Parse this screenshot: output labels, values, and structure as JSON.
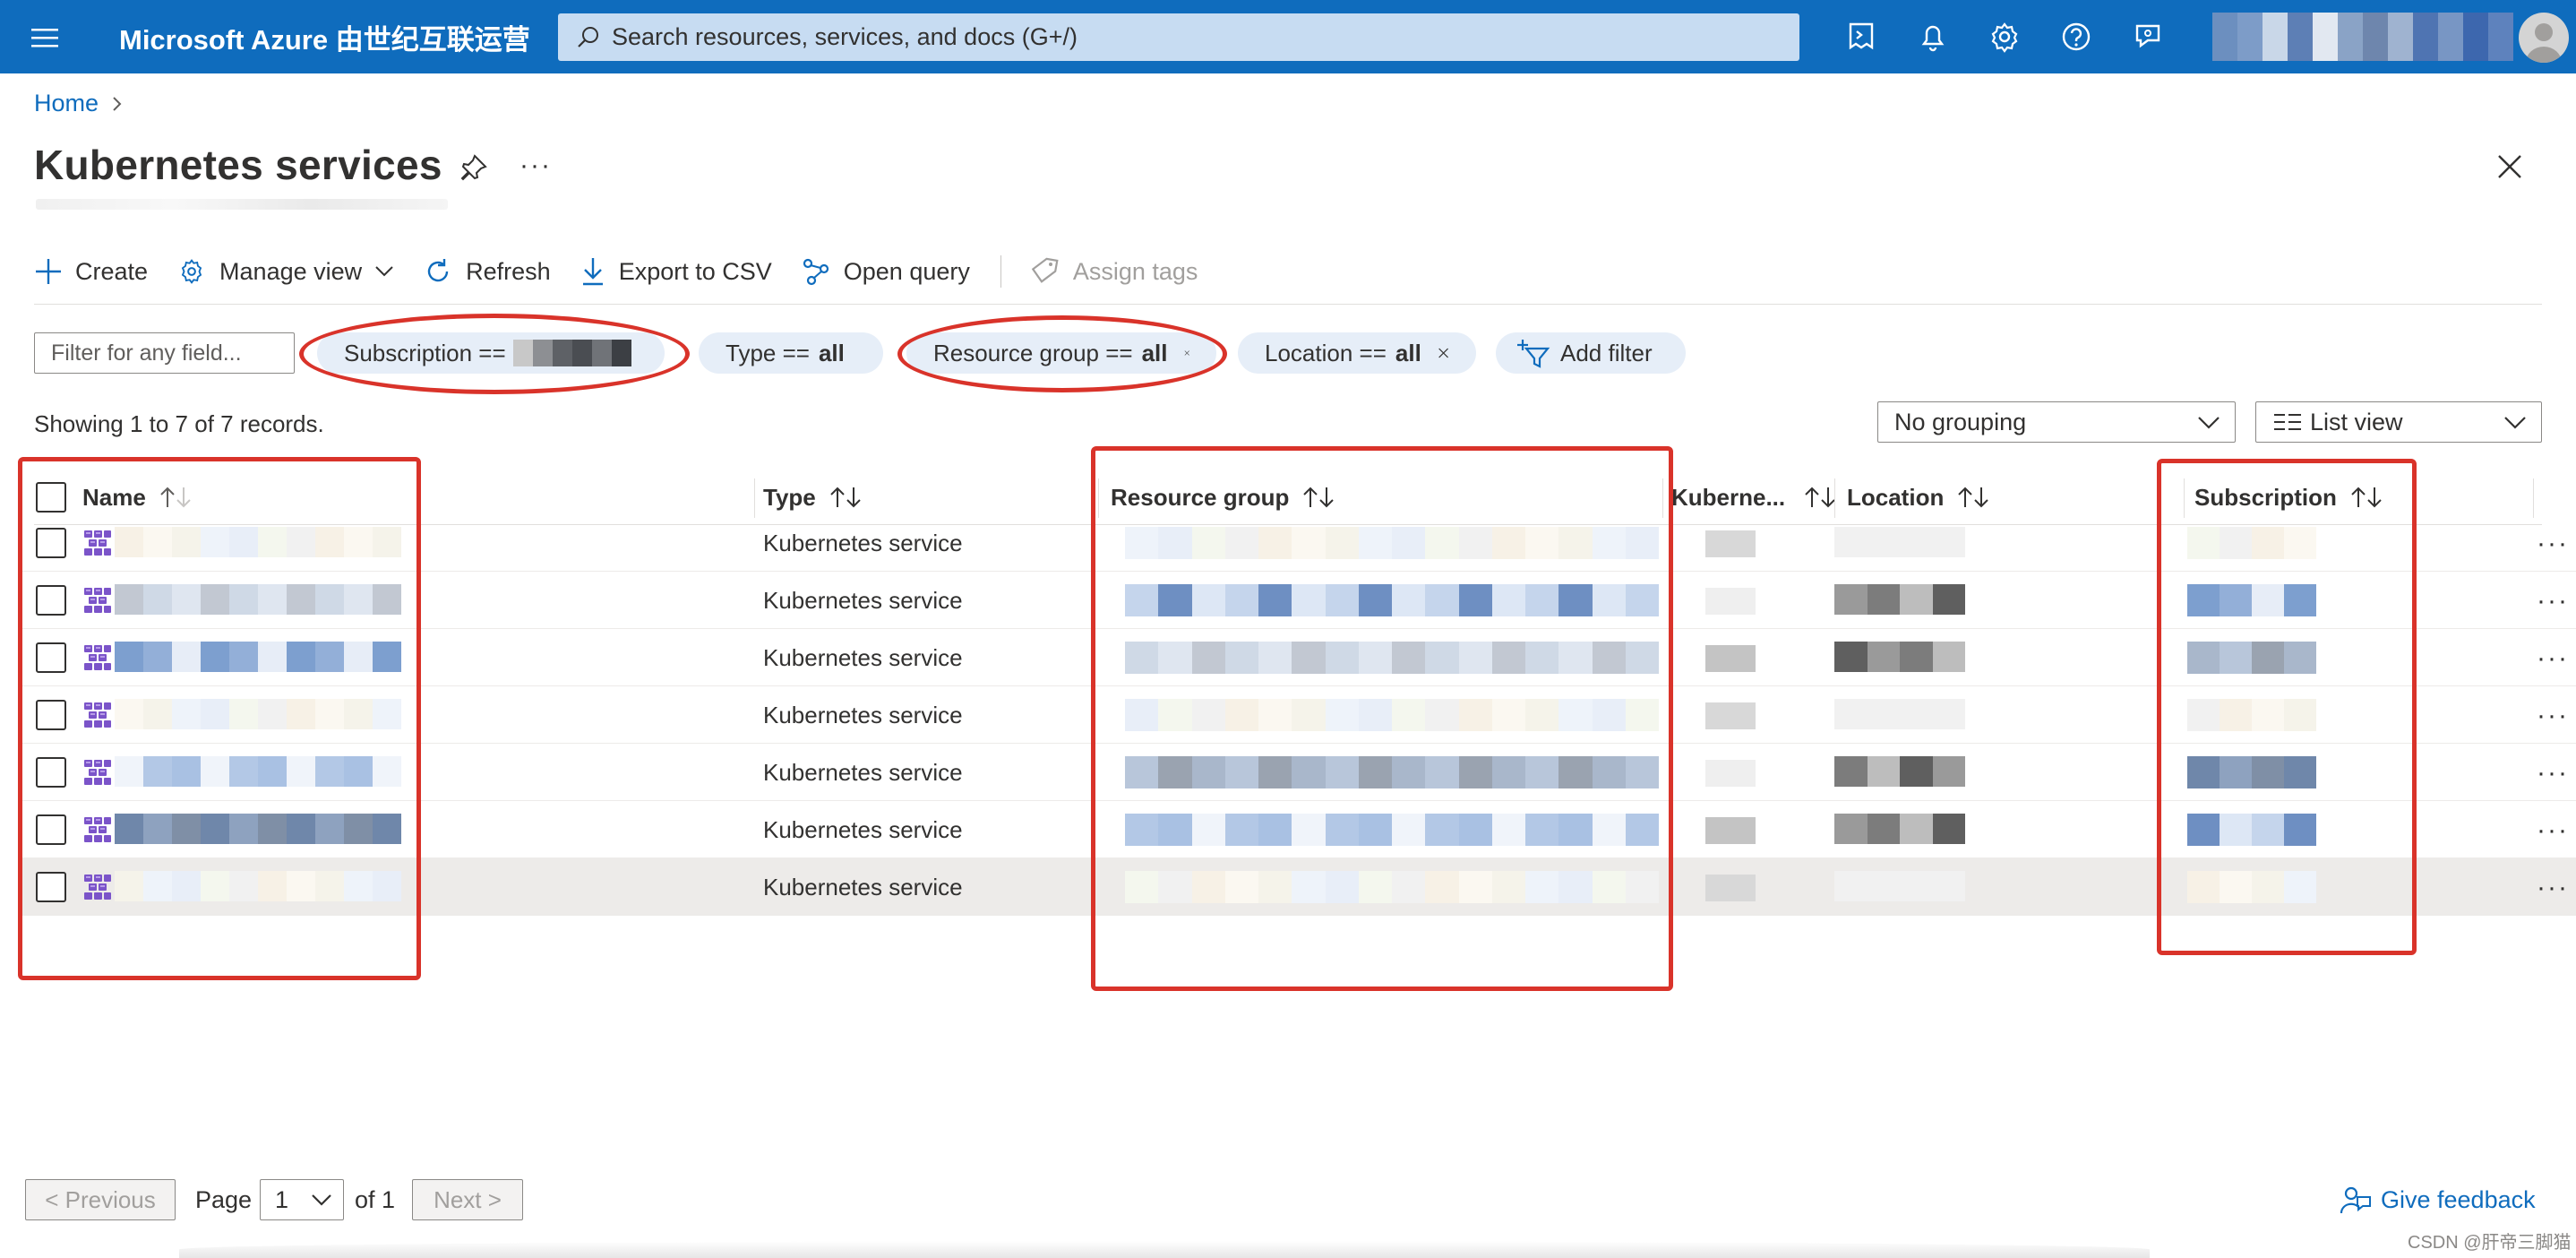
{
  "header": {
    "brand": "Microsoft Azure 由世纪互联运营",
    "search_placeholder": "Search resources, services, and docs (G+/)",
    "icons": [
      "hamburger-icon",
      "cloud-shell-icon",
      "bell-icon",
      "gear-icon",
      "help-icon",
      "feedback-icon"
    ]
  },
  "breadcrumb": {
    "home": "Home"
  },
  "page": {
    "title": "Kubernetes services"
  },
  "toolbar": {
    "create": "Create",
    "manage_view": "Manage view",
    "refresh": "Refresh",
    "export_csv": "Export to CSV",
    "open_query": "Open query",
    "assign_tags": "Assign tags"
  },
  "filters": {
    "placeholder": "Filter for any field...",
    "subscription_label": "Subscription ==",
    "type_label": "Type ==",
    "type_value": "all",
    "rg_label": "Resource group ==",
    "rg_value": "all",
    "location_label": "Location ==",
    "location_value": "all",
    "add_filter": "Add filter"
  },
  "records": "Showing 1 to 7 of 7 records.",
  "grouping": {
    "selected": "No grouping"
  },
  "view": {
    "selected": "List view"
  },
  "table": {
    "columns": {
      "name": "Name",
      "type": "Type",
      "resource_group": "Resource group",
      "kubernetes": "Kuberne...",
      "location": "Location",
      "subscription": "Subscription"
    },
    "rows": [
      {
        "type": "Kubernetes service",
        "selected": false
      },
      {
        "type": "Kubernetes service",
        "selected": false
      },
      {
        "type": "Kubernetes service",
        "selected": false
      },
      {
        "type": "Kubernetes service",
        "selected": false
      },
      {
        "type": "Kubernetes service",
        "selected": false
      },
      {
        "type": "Kubernetes service",
        "selected": false
      },
      {
        "type": "Kubernetes service",
        "selected": false,
        "hovered": true
      }
    ]
  },
  "pagination": {
    "previous": "< Previous",
    "page_label": "Page",
    "page_value": "1",
    "of_label": "of 1",
    "next": "Next >"
  },
  "feedback": "Give feedback",
  "watermark": "CSDN @肝帝三脚猫",
  "colors": {
    "header_bg": "#0f6cbd",
    "link": "#0f6cbd",
    "annotation_red": "#d9332a",
    "pill_bg": "#e6eef8"
  }
}
